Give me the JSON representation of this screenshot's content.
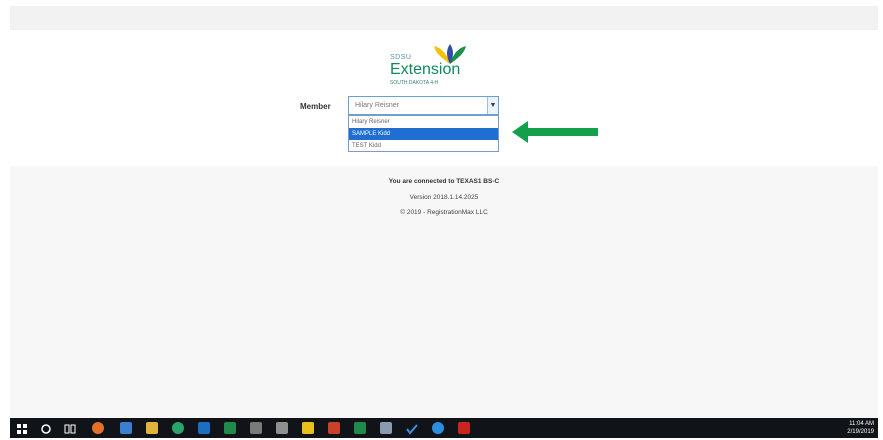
{
  "logo": {
    "small": "SDSU",
    "main": "Extension",
    "sub": "SOUTH DAKOTA 4-H"
  },
  "member": {
    "label": "Member",
    "selected": "Hilary Reisner",
    "options": [
      {
        "label": "Hilary Reisner",
        "selected": false
      },
      {
        "label": "SAMPLE Kidd",
        "selected": true
      },
      {
        "label": "TEST Kidd",
        "selected": false
      }
    ]
  },
  "info": {
    "connected": "You are connected to TEXAS1 BS-C",
    "version": "Version 2018.1.14.2025",
    "copyright": "© 2019 - RegistrationMax LLC"
  },
  "taskbar": {
    "time": "11:04 AM",
    "date": "2/19/2019",
    "icons": [
      "windows-start-icon",
      "search-icon",
      "task-view-icon",
      "firefox-icon",
      "people-icon",
      "file-explorer-icon",
      "chrome-icon",
      "outlook-icon",
      "excel-icon",
      "calculator-icon",
      "paint-icon",
      "sticky-notes-icon",
      "powerpoint-icon",
      "excel-icon",
      "snipping-icon",
      "checkmark-icon",
      "skype-icon",
      "acrobat-icon"
    ]
  },
  "colors": {
    "accent_green": "#14a04b",
    "highlight_blue": "#1f6fd1",
    "taskbar": "#101418"
  }
}
